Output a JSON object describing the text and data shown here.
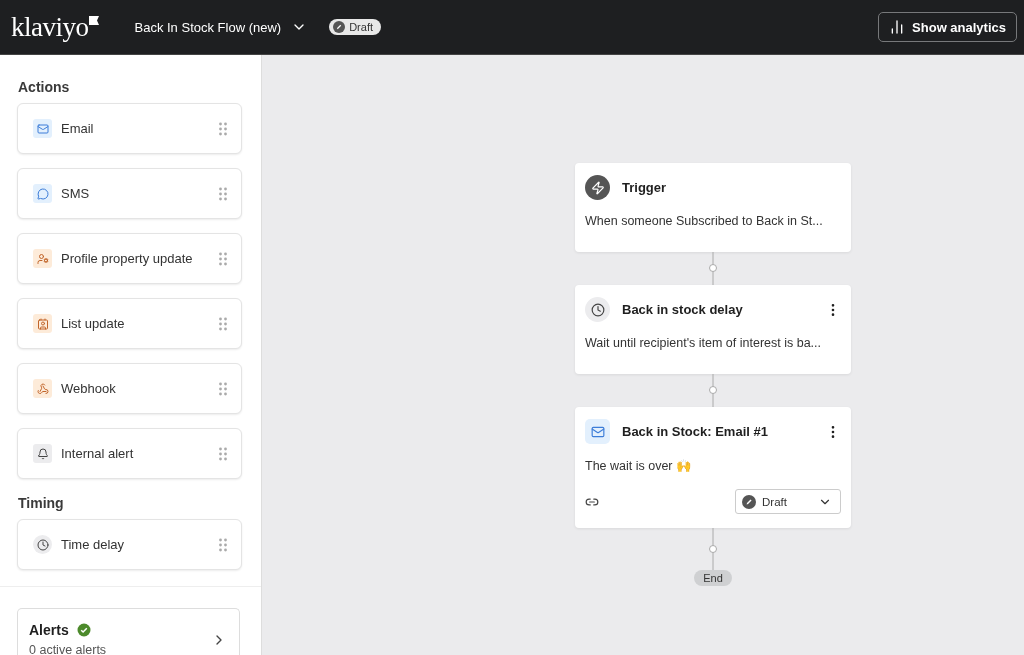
{
  "header": {
    "logo": "klaviyo",
    "flow_title": "Back In Stock Flow (new)",
    "status_badge": "Draft",
    "analytics_button": "Show analytics"
  },
  "sidebar": {
    "sections": [
      {
        "title": "Actions",
        "items": [
          {
            "label": "Email",
            "kind": "email"
          },
          {
            "label": "SMS",
            "kind": "sms"
          },
          {
            "label": "Profile property update",
            "kind": "profile"
          },
          {
            "label": "List update",
            "kind": "list"
          },
          {
            "label": "Webhook",
            "kind": "webhook"
          },
          {
            "label": "Internal alert",
            "kind": "alert"
          }
        ]
      },
      {
        "title": "Timing",
        "items": [
          {
            "label": "Time delay",
            "kind": "delay"
          }
        ]
      }
    ],
    "alerts": {
      "title": "Alerts",
      "subtitle": "0 active alerts"
    }
  },
  "flow": {
    "nodes": [
      {
        "kind": "trigger",
        "title": "Trigger",
        "description": "When someone Subscribed to Back in St..."
      },
      {
        "kind": "delay",
        "title": "Back in stock delay",
        "description": "Wait until recipient's item of interest is ba..."
      },
      {
        "kind": "email",
        "title": "Back in Stock: Email #1",
        "description": "The wait is over 🙌",
        "status": "Draft"
      }
    ],
    "end_label": "End"
  }
}
